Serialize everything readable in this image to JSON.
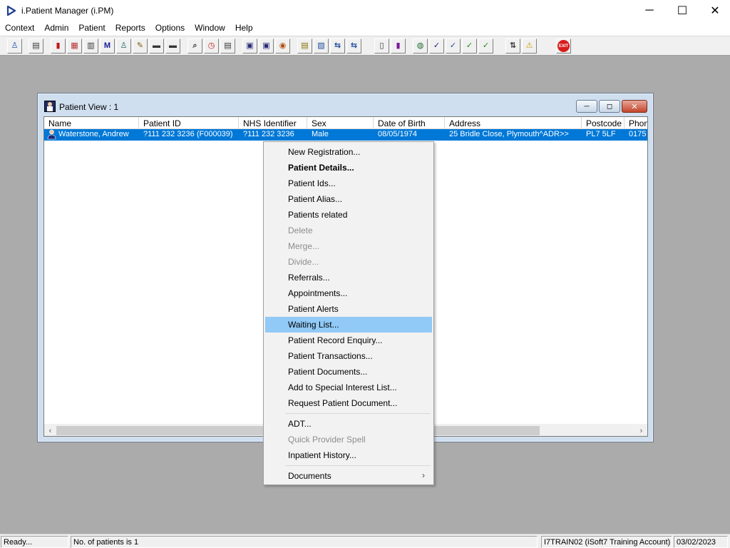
{
  "app": {
    "title": "i.Patient Manager (i.PM)",
    "icon": "play-triangle-icon",
    "min_glyph": "─",
    "max_glyph": "☐",
    "close_glyph": "✕"
  },
  "menubar": {
    "items": [
      {
        "label": "Context"
      },
      {
        "label": "Admin"
      },
      {
        "label": "Patient"
      },
      {
        "label": "Reports"
      },
      {
        "label": "Options"
      },
      {
        "label": "Window"
      },
      {
        "label": "Help"
      }
    ]
  },
  "toolbar": {
    "exit_label": "EXIT",
    "buttons": [
      {
        "icon": "patient-icon",
        "glyph": "♙"
      },
      {
        "icon": "printer-icon",
        "glyph": "▤"
      },
      {
        "icon": "book-icon",
        "glyph": "▮"
      },
      {
        "icon": "folders-icon",
        "glyph": "▦"
      },
      {
        "icon": "document-icon",
        "glyph": "▥"
      },
      {
        "icon": "m-icon",
        "glyph": "M"
      },
      {
        "icon": "doctor-icon",
        "glyph": "♙"
      },
      {
        "icon": "notepad-icon",
        "glyph": "✎"
      },
      {
        "icon": "bed-icon",
        "glyph": "▬"
      },
      {
        "icon": "bed-alt-icon",
        "glyph": "▬"
      },
      {
        "icon": "search-document-icon",
        "glyph": "⌕"
      },
      {
        "icon": "clock-icon",
        "glyph": "◷"
      },
      {
        "icon": "list-icon",
        "glyph": "▤"
      },
      {
        "icon": "screen-icon",
        "glyph": "▣"
      },
      {
        "icon": "screen-edit-icon",
        "glyph": "▣"
      },
      {
        "icon": "compass-icon",
        "glyph": "◉"
      },
      {
        "icon": "note-icon",
        "glyph": "▤"
      },
      {
        "icon": "note-search-icon",
        "glyph": "▧"
      },
      {
        "icon": "transfer-icon",
        "glyph": "⇆"
      },
      {
        "icon": "transfer-search-icon",
        "glyph": "⇆"
      },
      {
        "icon": "page-icon",
        "glyph": "▯"
      },
      {
        "icon": "bar-chart-icon",
        "glyph": "▮"
      },
      {
        "icon": "globe-icon",
        "glyph": "◍"
      },
      {
        "icon": "checklist-icon",
        "glyph": "✓"
      },
      {
        "icon": "checklist-blue-icon",
        "glyph": "✓"
      },
      {
        "icon": "checklist-green-icon",
        "glyph": "✓"
      },
      {
        "icon": "checklist-arrow-icon",
        "glyph": "✓"
      },
      {
        "icon": "swap-icon",
        "glyph": "⇅"
      },
      {
        "icon": "warning-icon",
        "glyph": "⚠"
      },
      {
        "icon": "exit-icon",
        "glyph": "●"
      }
    ]
  },
  "patient_view": {
    "title": "Patient View : 1",
    "min_glyph": "─",
    "max_glyph": "◻",
    "close_glyph": "✕",
    "columns": [
      "Name",
      "Patient ID",
      "NHS Identifier",
      "Sex",
      "Date of Birth",
      "Address",
      "Postcode",
      "Phon"
    ],
    "rows": [
      {
        "name": "Waterstone, Andrew",
        "patient_id": "?111 232 3236 (F000039)",
        "nhs": "?111 232 3236",
        "sex": "Male",
        "dob": "08/05/1974",
        "address": "25 Bridle Close, Plymouth^ADR>>",
        "postcode": "PL7 5LF",
        "phone": "0175"
      }
    ],
    "scroll_left": "‹",
    "scroll_right": "›"
  },
  "context_menu": {
    "items": [
      {
        "label": "New Registration...",
        "disabled": false
      },
      {
        "label": "Patient Details...",
        "bold": true
      },
      {
        "label": "Patient Ids..."
      },
      {
        "label": "Patient Alias..."
      },
      {
        "label": "Patients related"
      },
      {
        "label": "Delete",
        "disabled": true
      },
      {
        "label": "Merge...",
        "disabled": true
      },
      {
        "label": "Divide...",
        "disabled": true
      },
      {
        "label": "Referrals..."
      },
      {
        "label": "Appointments..."
      },
      {
        "label": "Patient Alerts"
      },
      {
        "label": "Waiting List...",
        "highlighted": true
      },
      {
        "label": "Patient Record Enquiry..."
      },
      {
        "label": "Patient Transactions..."
      },
      {
        "label": "Patient Documents..."
      },
      {
        "label": "Add to Special Interest List..."
      },
      {
        "label": "Request Patient Document..."
      },
      {
        "label": "ADT..."
      },
      {
        "label": "Quick Provider Spell",
        "disabled": true
      },
      {
        "label": "Inpatient History..."
      },
      {
        "label": "Documents",
        "submenu": true
      }
    ],
    "submenu_arrow": "›"
  },
  "statusbar": {
    "ready": "Ready...",
    "patients": "No. of patients is 1",
    "account": "I7TRAIN02 (iSoft7 Training Account)",
    "date": "03/02/2023"
  },
  "colors": {
    "selection": "#0078d7",
    "menu_highlight": "#91c9f7",
    "mdi_background": "#ababab"
  }
}
